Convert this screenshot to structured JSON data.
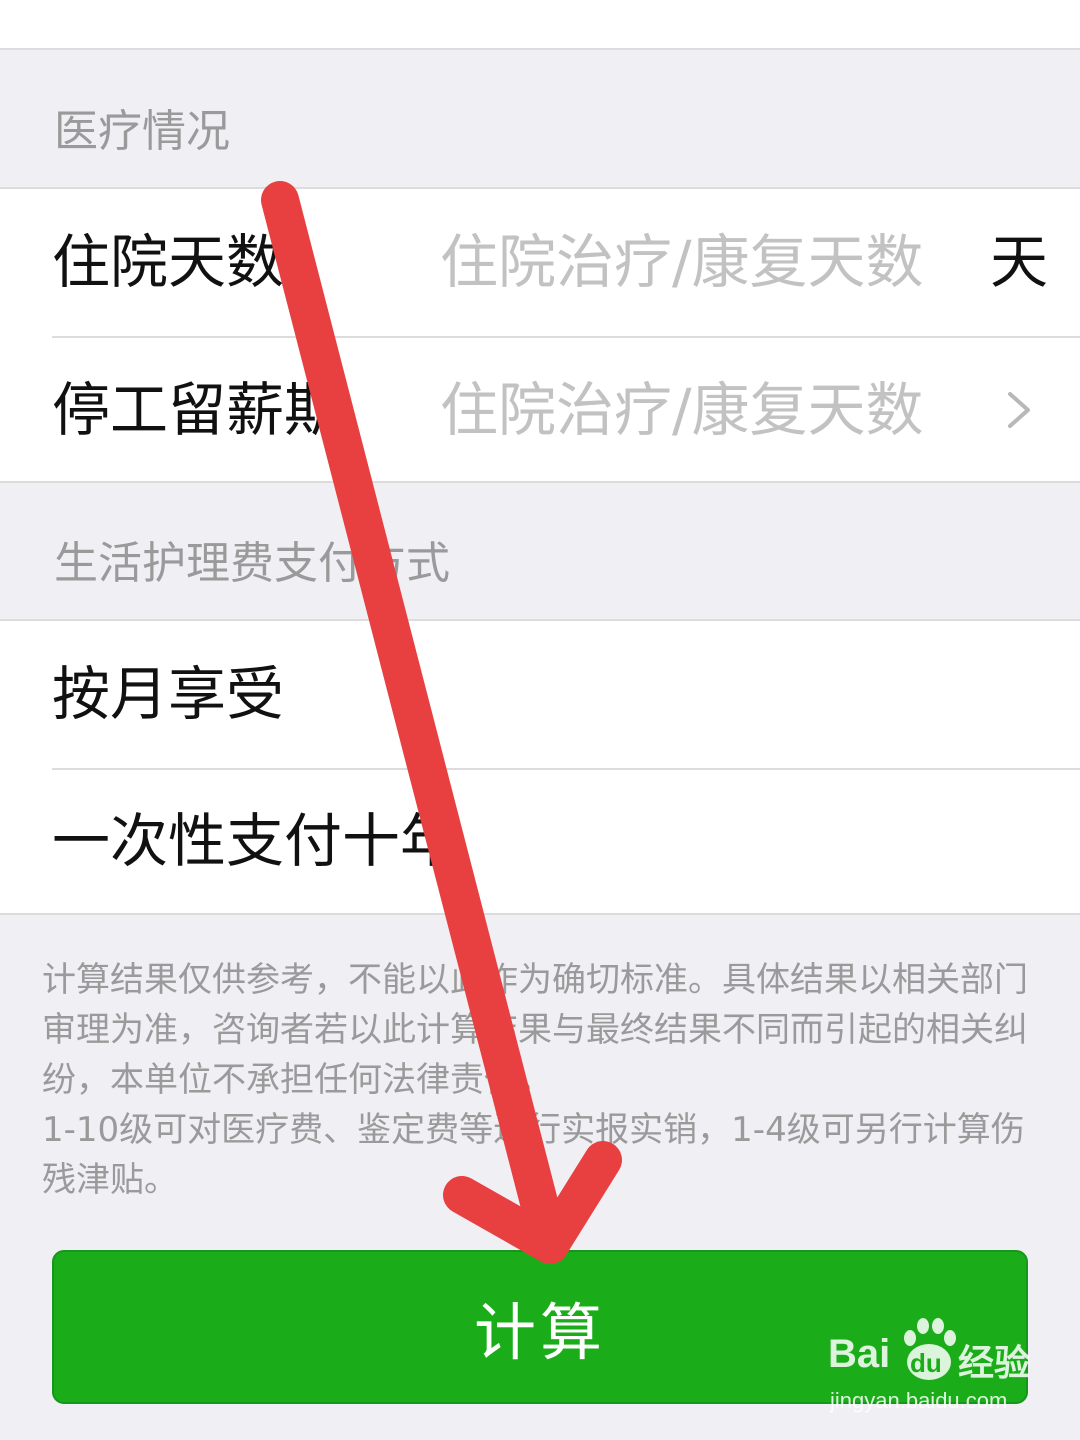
{
  "sections": {
    "medical": {
      "title": "医疗情况",
      "rows": [
        {
          "label": "住院天数",
          "placeholder": "住院治疗/康复天数",
          "suffix": "天"
        },
        {
          "label": "停工留薪期",
          "placeholder": "住院治疗/康复天数"
        }
      ]
    },
    "care": {
      "title": "生活护理费支付方式",
      "options": [
        "按月享受",
        "一次性支付十年"
      ]
    }
  },
  "notice": {
    "line1": "计算结果仅供参考，不能以此作为确切标准。具体结果以相关部门审理为准，咨询者若以此计算结果与最终结果不同而引起的相关纠纷，本单位不承担任何法律责任。",
    "line2": "1-10级可对医疗费、鉴定费等进行实报实销，1-4级可另行计算伤残津贴。"
  },
  "button": {
    "label": "计算"
  },
  "watermark": {
    "brand": "Bai",
    "brand2": "du",
    "suffix": "经验",
    "url": "jingyan.baidu.com"
  },
  "colors": {
    "primary": "#1aad19",
    "arrow": "#e84040",
    "background": "#efeff4"
  }
}
